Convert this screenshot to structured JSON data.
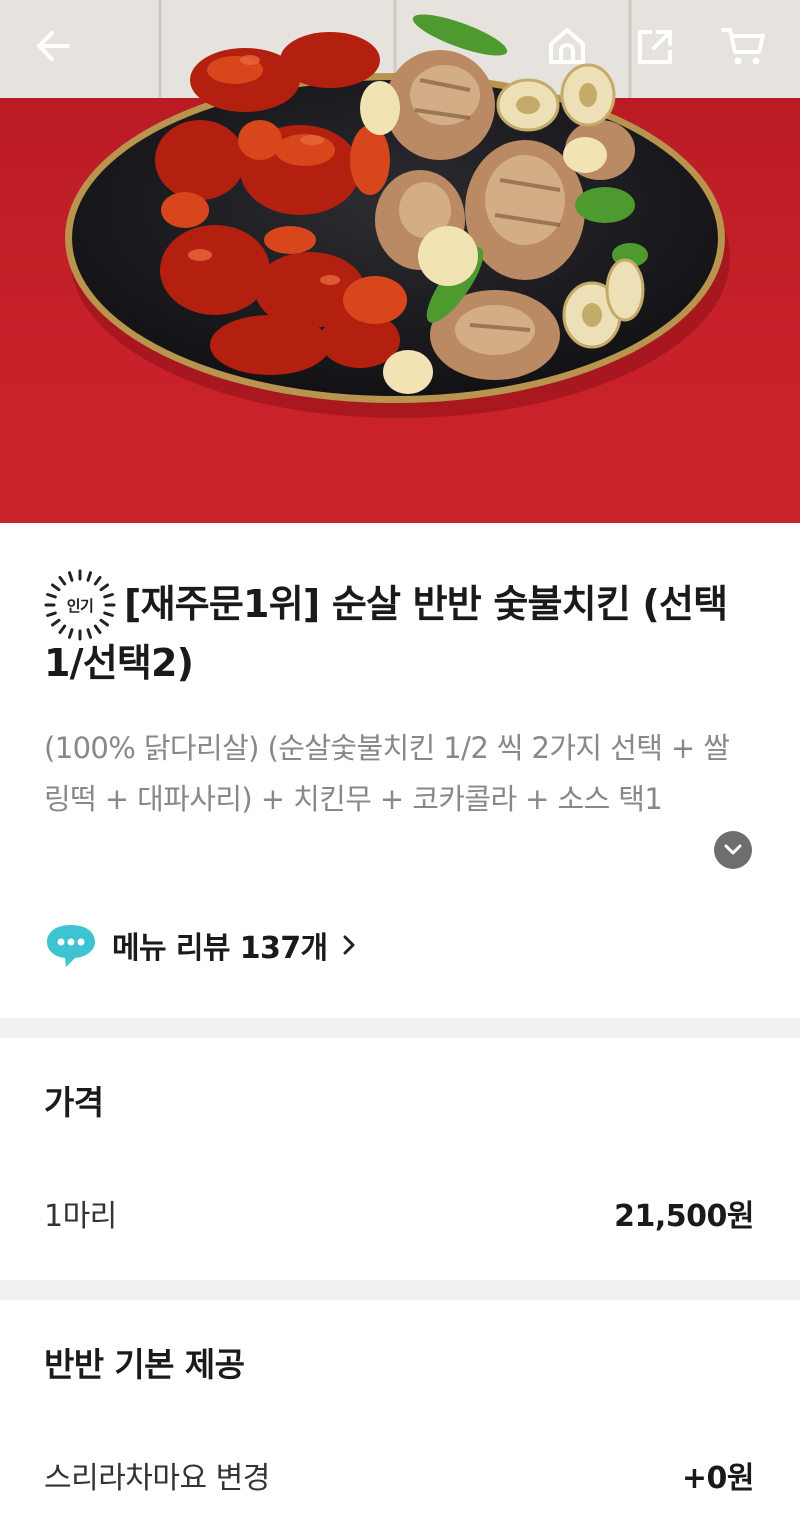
{
  "nav": {
    "back_icon": "back-arrow-icon",
    "home_icon": "home-icon",
    "share_icon": "share-icon",
    "cart_icon": "cart-icon"
  },
  "product": {
    "badge": "인기",
    "title": "[재주문1위] 순살 반반 숯불치킨 (선택1/선택2)",
    "description": "(100% 닭다리살) (순살숯불치킨 1/2 씩 2가지 선택 + 쌀링떡 + 대파사리) + 치킨무 + 코카콜라 + 소스 택1",
    "review_label": "메뉴 리뷰 137개",
    "review_icon": "chat-bubble-icon"
  },
  "price_section": {
    "title": "가격",
    "items": [
      {
        "label": "1마리",
        "value": "21,500원"
      }
    ]
  },
  "option_section": {
    "title": "반반 기본 제공",
    "items": [
      {
        "label": "스리라차마요 변경",
        "value": "+0원"
      }
    ]
  },
  "colors": {
    "hero_background": "#c8202a",
    "wall": "#e6e2dd",
    "plate": "#1e1e22",
    "plate_rim": "#b8944e",
    "divider": "#f1f1f1",
    "review_icon": "#3ec4d0",
    "expand_button": "#6e6e6e"
  }
}
